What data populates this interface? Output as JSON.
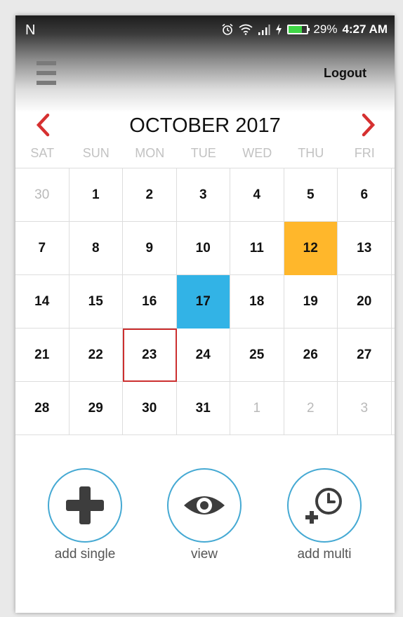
{
  "status": {
    "carrier": "N",
    "icons": [
      "alarm-icon",
      "wifi-icon",
      "signal-icon",
      "charging-icon",
      "battery-icon"
    ],
    "battery": "29%",
    "battery_level": 0.29,
    "time": "4:27 AM"
  },
  "header": {
    "logout_label": "Logout",
    "menu_icon": "hamburger-menu-icon"
  },
  "calendar": {
    "month": "OCTOBER 2017",
    "prev_icon": "chevron-left-icon",
    "next_icon": "chevron-right-icon",
    "weekdays": [
      "SAT",
      "SUN",
      "MON",
      "TUE",
      "WED",
      "THU",
      "FRI"
    ],
    "weeks": [
      [
        "30",
        "1",
        "2",
        "3",
        "4",
        "5",
        "6"
      ],
      [
        "7",
        "8",
        "9",
        "10",
        "11",
        "12",
        "13"
      ],
      [
        "14",
        "15",
        "16",
        "17",
        "18",
        "19",
        "20"
      ],
      [
        "21",
        "22",
        "23",
        "24",
        "25",
        "26",
        "27"
      ],
      [
        "28",
        "29",
        "30",
        "31",
        "1",
        "2",
        "3"
      ]
    ],
    "highlight_colors": {
      "selected": "#ffb72b",
      "current": "#32b3e6",
      "today_border": "#cc2f2f"
    }
  },
  "actions": [
    {
      "label": "add single",
      "icon": "plus-icon"
    },
    {
      "label": "view",
      "icon": "eye-icon"
    },
    {
      "label": "add multi",
      "icon": "clock-plus-icon"
    }
  ],
  "accent_color": "#d63030"
}
